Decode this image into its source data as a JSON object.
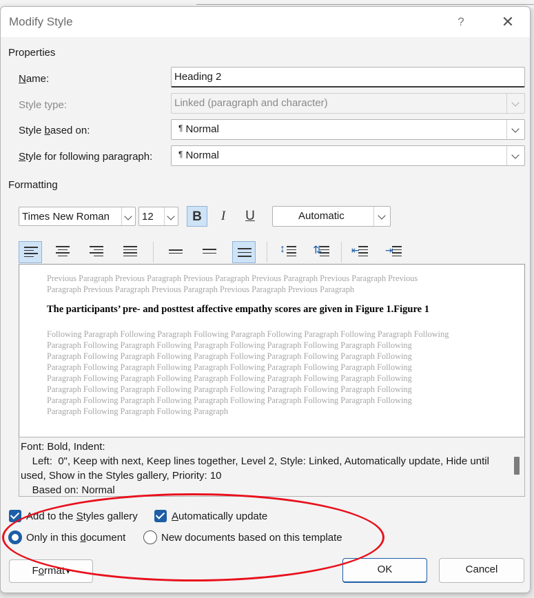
{
  "dialog": {
    "title": "Modify Style",
    "help_glyph": "?",
    "close_glyph": "✕"
  },
  "properties": {
    "section_label": "Properties",
    "name": {
      "label_pre": "",
      "label_ul": "N",
      "label_post": "ame:",
      "value": "Heading 2"
    },
    "style_type": {
      "label": "Style type:",
      "value": "Linked (paragraph and character)"
    },
    "based_on": {
      "label_pre": "Style ",
      "label_ul": "b",
      "label_post": "ased on:",
      "value": "Normal",
      "marker": "¶"
    },
    "following": {
      "label_pre": "",
      "label_ul": "S",
      "label_post": "tyle for following paragraph:",
      "value": "Normal",
      "marker": "¶"
    }
  },
  "formatting": {
    "section_label": "Formatting",
    "font": "Times New Roman",
    "size": "12",
    "bold": "B",
    "italic": "I",
    "underline": "U",
    "color": "Automatic",
    "bold_active": true,
    "align_active": "left",
    "spacing_active": "double"
  },
  "preview": {
    "previous": [
      "Previous Paragraph Previous Paragraph Previous Paragraph Previous Paragraph Previous Paragraph Previous",
      "Paragraph Previous Paragraph Previous Paragraph Previous Paragraph Previous Paragraph"
    ],
    "sample": "The participants’ pre- and posttest affective empathy scores are given in Figure 1.Figure 1",
    "following": [
      "Following Paragraph Following Paragraph Following Paragraph Following Paragraph Following Paragraph Following",
      "Paragraph Following Paragraph Following Paragraph Following Paragraph Following Paragraph Following",
      "Paragraph Following Paragraph Following Paragraph Following Paragraph Following Paragraph Following",
      "Paragraph Following Paragraph Following Paragraph Following Paragraph Following Paragraph Following",
      "Paragraph Following Paragraph Following Paragraph Following Paragraph Following Paragraph Following",
      "Paragraph Following Paragraph Following Paragraph Following Paragraph Following Paragraph Following",
      "Paragraph Following Paragraph Following Paragraph Following Paragraph Following Paragraph Following",
      "Paragraph Following Paragraph Following Paragraph"
    ]
  },
  "description": "Font: Bold, Indent:\n    Left:  0\", Keep with next, Keep lines together, Level 2, Style: Linked, Automatically update, Hide until used, Show in the Styles gallery, Priority: 10\n    Based on: Normal",
  "options": {
    "add_to_gallery": {
      "pre": "Add to the ",
      "ul": "S",
      "post": "tyles gallery",
      "checked": true
    },
    "auto_update": {
      "pre": "",
      "ul": "A",
      "post": "utomatically update",
      "checked": true
    },
    "only_this_doc": {
      "pre": "Only in this ",
      "ul": "d",
      "post": "ocument",
      "selected": true
    },
    "new_docs": {
      "label": "New documents based on this template",
      "selected": false
    }
  },
  "buttons": {
    "format_pre": "F",
    "format_ul": "o",
    "format_post": "rmat",
    "format_arrow": "▾",
    "ok": "OK",
    "cancel": "Cancel"
  },
  "colors": {
    "accent": "#1d5ea6",
    "highlight_ellipse": "#e8101c"
  }
}
